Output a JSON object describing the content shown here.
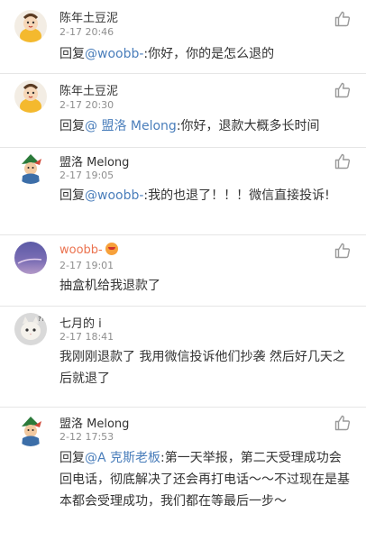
{
  "comments": [
    {
      "username": "陈年土豆泥",
      "time": "2-17 20:46",
      "prefix": "回复",
      "mention": "@woobb-",
      "body": ":你好，你的是怎么退的",
      "avatar": "chick-icon"
    },
    {
      "username": "陈年土豆泥",
      "time": "2-17 20:30",
      "prefix": "回复",
      "mention": "@ 盟洛 Melong",
      "body": ":你好，退款大概多长时间",
      "avatar": "chick-icon"
    },
    {
      "username": "盟洛 Melong",
      "time": "2-17 19:05",
      "prefix": "回复",
      "mention": "@woobb-",
      "body": ":我的也退了！！！微信直接投诉!",
      "avatar": "cartoon-character-icon"
    },
    {
      "username": "woobb-",
      "time": "2-17 19:01",
      "body": "抽盒机给我退款了",
      "avatar": "purple-sky-icon",
      "badge": "emoji-badge-icon"
    },
    {
      "username": "七月的 i",
      "time": "2-17 18:41",
      "body": "我刚刚退款了 我用微信投诉他们抄袭 然后好几天之后就退了",
      "avatar": "kitten-icon"
    },
    {
      "username": "盟洛 Melong",
      "time": "2-12 17:53",
      "prefix": "回复",
      "mention": "@A 克斯老板",
      "body": ":第一天举报，第二天受理成功会回电话，彻底解决了还会再打电话～～不过现在是基本都会受理成功，我们都在等最后一步～",
      "avatar": "cartoon-character-icon"
    }
  ],
  "colors": {
    "mention": "#4a7ebb",
    "highlight_username": "#eb7350",
    "time": "#8f8f8f",
    "divider": "#e6e6e6"
  },
  "icons": {
    "like": "thumbs-up-icon"
  }
}
